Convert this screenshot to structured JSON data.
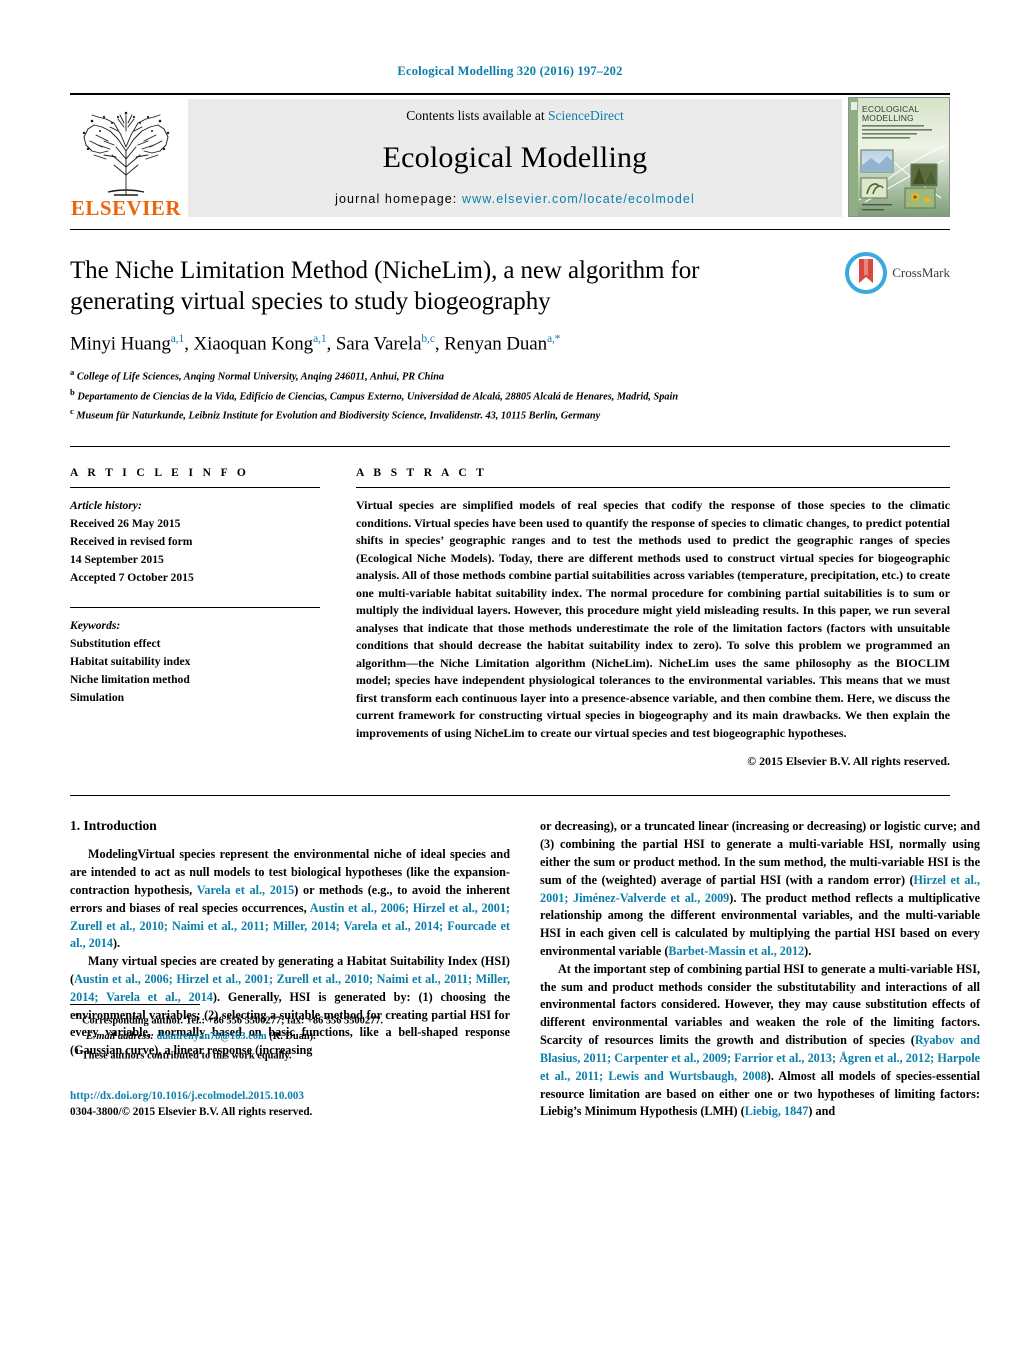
{
  "running_head": "Ecological Modelling 320 (2016) 197–202",
  "masthead": {
    "publisher_name": "ELSEVIER",
    "contents_prefix": "Contents lists available at ",
    "contents_link": "ScienceDirect",
    "journal_name": "Ecological Modelling",
    "homepage_label": "journal homepage:",
    "homepage_url": "www.elsevier.com/locate/ecolmodel",
    "cover_title_line1": "ECOLOGICAL",
    "cover_title_line2": "MODELLING"
  },
  "article": {
    "title": "The Niche Limitation Method (NicheLim), a new algorithm for generating virtual species to study biogeography",
    "authors": [
      {
        "name": "Minyi Huang",
        "sup": "a,1",
        "sep": ", "
      },
      {
        "name": "Xiaoquan Kong",
        "sup": "a,1",
        "sep": ", "
      },
      {
        "name": "Sara Varela",
        "sup": "b,c",
        "sep": ", "
      },
      {
        "name": "Renyan Duan",
        "sup": "a,*",
        "sep": ""
      }
    ],
    "affiliations": [
      {
        "marker": "a",
        "text": "College of Life Sciences, Anqing Normal University, Anqing 246011, Anhui, PR China"
      },
      {
        "marker": "b",
        "text": "Departamento de Ciencias de la Vida, Edificio de Ciencias, Campus Externo, Universidad de Alcalá, 28805 Alcalá de Henares, Madrid, Spain"
      },
      {
        "marker": "c",
        "text": "Museum für Naturkunde, Leibniz Institute for Evolution and Biodiversity Science, Invalidenstr. 43, 10115 Berlin, Germany"
      }
    ],
    "crossmark_label": "CrossMark"
  },
  "article_info": {
    "heading": "A R T I C L E   I N F O",
    "history_label": "Article history:",
    "history": [
      "Received 26 May 2015",
      "Received in revised form",
      "14 September 2015",
      "Accepted 7 October 2015"
    ],
    "keywords_label": "Keywords:",
    "keywords": [
      "Substitution effect",
      "Habitat suitability index",
      "Niche limitation method",
      "Simulation"
    ]
  },
  "abstract": {
    "heading": "A B S T R A C T",
    "text": "Virtual species are simplified models of real species that codify the response of those species to the climatic conditions. Virtual species have been used to quantify the response of species to climatic changes, to predict potential shifts in species’ geographic ranges and to test the methods used to predict the geographic ranges of species (Ecological Niche Models). Today, there are different methods used to construct virtual species for biogeographic analysis. All of those methods combine partial suitabilities across variables (temperature, precipitation, etc.) to create one multi-variable habitat suitability index. The normal procedure for combining partial suitabilities is to sum or multiply the individual layers. However, this procedure might yield misleading results. In this paper, we run several analyses that indicate that those methods underestimate the role of the limitation factors (factors with unsuitable conditions that should decrease the habitat suitability index to zero). To solve this problem we programmed an algorithm—the Niche Limitation algorithm (NicheLim). NicheLim uses the same philosophy as the BIOCLIM model; species have independent physiological tolerances to the environmental variables. This means that we must first transform each continuous layer into a presence-absence variable, and then combine them. Here, we discuss the current framework for constructing virtual species in biogeography and its main drawbacks. We then explain the improvements of using NicheLim to create our virtual species and test biogeographic hypotheses.",
    "copyright": "© 2015 Elsevier B.V. All rights reserved."
  },
  "body": {
    "section_title": "1.  Introduction",
    "left_paragraphs": [
      {
        "runs": [
          {
            "t": "ModelingVirtual species represent the environmental niche of ideal species and are intended to act as null models to test biological hypotheses (like the expansion-contraction hypothesis, ",
            "link": false
          },
          {
            "t": "Varela et al., 2015",
            "link": true
          },
          {
            "t": ") or methods (e.g., to avoid the inherent errors and biases of real species occurrences, ",
            "link": false
          },
          {
            "t": "Austin et al., 2006; Hirzel et al., 2001; Zurell et al., 2010; Naimi et al., 2011; Miller, 2014; Varela et al., 2014; Fourcade et al., 2014",
            "link": true
          },
          {
            "t": ").",
            "link": false
          }
        ]
      },
      {
        "runs": [
          {
            "t": "Many virtual species are created by generating a Habitat Suitability Index (HSI) (",
            "link": false
          },
          {
            "t": "Austin et al., 2006; Hirzel et al., 2001; Zurell et al., 2010; Naimi et al., 2011; Miller, 2014; Varela et al., 2014",
            "link": true
          },
          {
            "t": "). Generally, HSI is generated by: (1) choosing the environmental variables; (2) selecting a suitable method for creating partial HSI for every variable, normally based on basic functions, like a bell-shaped response (Gaussian curve), a linear response (increasing",
            "link": false
          }
        ]
      }
    ],
    "right_paragraphs": [
      {
        "no_indent": true,
        "runs": [
          {
            "t": "or decreasing), or a truncated linear (increasing or decreasing) or logistic curve; and (3) combining the partial HSI to generate a multi-variable HSI, normally using either the sum or product method. In the sum method, the multi-variable HSI is the sum of the (weighted) average of partial HSI (with a random error) (",
            "link": false
          },
          {
            "t": "Hirzel et al., 2001; Jiménez-Valverde et al., 2009",
            "link": true
          },
          {
            "t": "). The product method reflects a multiplicative relationship among the different environmental variables, and the multi-variable HSI in each given cell is calculated by multiplying the partial HSI based on every environmental variable (",
            "link": false
          },
          {
            "t": "Barbet-Massin et al., 2012",
            "link": true
          },
          {
            "t": ").",
            "link": false
          }
        ]
      },
      {
        "runs": [
          {
            "t": "At the important step of combining partial HSI to generate a multi-variable HSI, the sum and product methods consider the substitutability and interactions of all environmental factors considered. However, they may cause substitution effects of different environmental variables and weaken the role of the limiting factors. Scarcity of resources limits the growth and distribution of species (",
            "link": false
          },
          {
            "t": "Ryabov and Blasius, 2011; Carpenter et al., 2009; Farrior et al., 2013; Ågren et al., 2012; Harpole et al., 2011; Lewis and Wurtsbaugh, 2008",
            "link": true
          },
          {
            "t": "). Almost all models of species-essential resource limitation are based on either one or two hypotheses of limiting factors: Liebig’s Minimum Hypothesis (LMH) (",
            "link": false
          },
          {
            "t": "Liebig, 1847",
            "link": true
          },
          {
            "t": ") and",
            "link": false
          }
        ]
      }
    ]
  },
  "footnotes": {
    "corresponding": {
      "marker": "*",
      "text": "Corresponding author. Tel.: +86 556 5500277; fax: +86 556 5500277.",
      "email_label": "E-mail address:",
      "email": "duanrenyan78@163.com",
      "email_suffix": " (R. Duan)."
    },
    "equal_contrib": {
      "marker": "1",
      "text": "These authors contributed to this work equally."
    },
    "doi": "http://dx.doi.org/10.1016/j.ecolmodel.2015.10.003",
    "issn_line": "0304-3800/© 2015 Elsevier B.V. All rights reserved."
  },
  "colors": {
    "link": "#0b7fab",
    "elsevier_orange": "#ec6608",
    "masthead_grey": "#ebebeb"
  }
}
